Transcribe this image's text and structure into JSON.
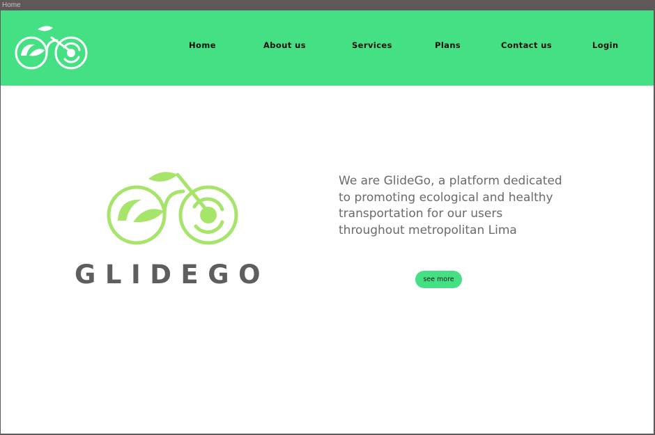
{
  "window": {
    "title": "Home"
  },
  "colors": {
    "accent": "#46e084",
    "logo_green": "#a6e46a",
    "text_gray": "#6a6a6a",
    "brand_gray": "#5e5e5e"
  },
  "header": {
    "logo_icon": "bicycle-leaf-logo",
    "nav": [
      {
        "label": "Home"
      },
      {
        "label": "About us"
      },
      {
        "label": "Services"
      },
      {
        "label": "Plans"
      },
      {
        "label": "Contact us"
      },
      {
        "label": "Login"
      }
    ]
  },
  "hero": {
    "logo_icon": "bicycle-leaf-logo",
    "brand": "GLIDEGO",
    "tagline": "We are GlideGo, a platform dedicated to promoting ecological and healthy transportation for our users throughout metropolitan Lima",
    "cta_label": "see more"
  }
}
